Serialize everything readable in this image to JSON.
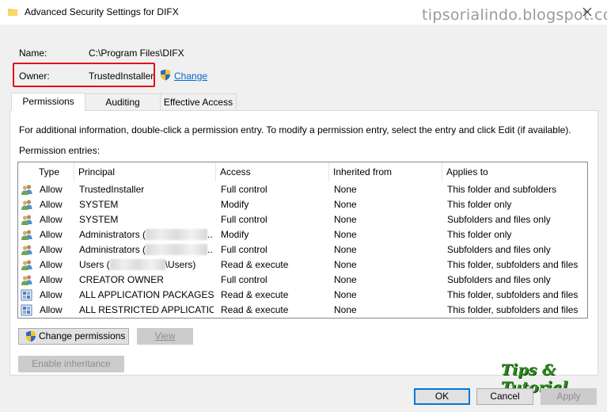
{
  "window": {
    "title": "Advanced Security Settings for DIFX",
    "watermark": "tipsorialindo.blogspot.com"
  },
  "info": {
    "name_label": "Name:",
    "name_value": "C:\\Program Files\\DIFX",
    "owner_label": "Owner:",
    "owner_value": "TrustedInstaller",
    "change_link": "Change"
  },
  "tabs": [
    {
      "label": "Permissions",
      "active": true
    },
    {
      "label": "Auditing",
      "active": false
    },
    {
      "label": "Effective Access",
      "active": false
    }
  ],
  "description": "For additional information, double-click a permission entry. To modify a permission entry, select the entry and click Edit (if available).",
  "entries_label": "Permission entries:",
  "columns": {
    "type": "Type",
    "principal": "Principal",
    "access": "Access",
    "inherited": "Inherited from",
    "applies": "Applies to"
  },
  "rows": [
    {
      "icon": "user-group-icon",
      "type": "Allow",
      "principal": "TrustedInstaller",
      "principal_suffix": "",
      "access": "Full control",
      "inherited": "None",
      "applies": "This folder and subfolders"
    },
    {
      "icon": "user-group-icon",
      "type": "Allow",
      "principal": "SYSTEM",
      "principal_suffix": "",
      "access": "Modify",
      "inherited": "None",
      "applies": "This folder only"
    },
    {
      "icon": "user-group-icon",
      "type": "Allow",
      "principal": "SYSTEM",
      "principal_suffix": "",
      "access": "Full control",
      "inherited": "None",
      "applies": "Subfolders and files only"
    },
    {
      "icon": "user-group-icon",
      "type": "Allow",
      "principal": "Administrators (",
      "principal_suffix": "...",
      "access": "Modify",
      "inherited": "None",
      "applies": "This folder only"
    },
    {
      "icon": "user-group-icon",
      "type": "Allow",
      "principal": "Administrators (",
      "principal_suffix": "...",
      "access": "Full control",
      "inherited": "None",
      "applies": "Subfolders and files only"
    },
    {
      "icon": "user-group-icon",
      "type": "Allow",
      "principal": "Users (",
      "principal_suffix": "\\Users)",
      "access": "Read & execute",
      "inherited": "None",
      "applies": "This folder, subfolders and files"
    },
    {
      "icon": "user-group-icon",
      "type": "Allow",
      "principal": "CREATOR OWNER",
      "principal_suffix": "",
      "access": "Full control",
      "inherited": "None",
      "applies": "Subfolders and files only"
    },
    {
      "icon": "app-package-icon",
      "type": "Allow",
      "principal": "ALL APPLICATION PACKAGES",
      "principal_suffix": "",
      "access": "Read & execute",
      "inherited": "None",
      "applies": "This folder, subfolders and files"
    },
    {
      "icon": "app-package-icon",
      "type": "Allow",
      "principal": "ALL RESTRICTED APPLICATIO...",
      "principal_suffix": "",
      "access": "Read & execute",
      "inherited": "None",
      "applies": "This folder, subfolders and files"
    }
  ],
  "buttons": {
    "change_permissions": "Change permissions",
    "view": "View",
    "enable_inheritance": "Enable inheritance",
    "ok": "OK",
    "cancel": "Cancel",
    "apply": "Apply"
  },
  "badge": "Tips & Tutorial",
  "colors": {
    "owner_highlight": "#e0101a",
    "link": "#0066cc",
    "badge": "#2b8a1c"
  }
}
